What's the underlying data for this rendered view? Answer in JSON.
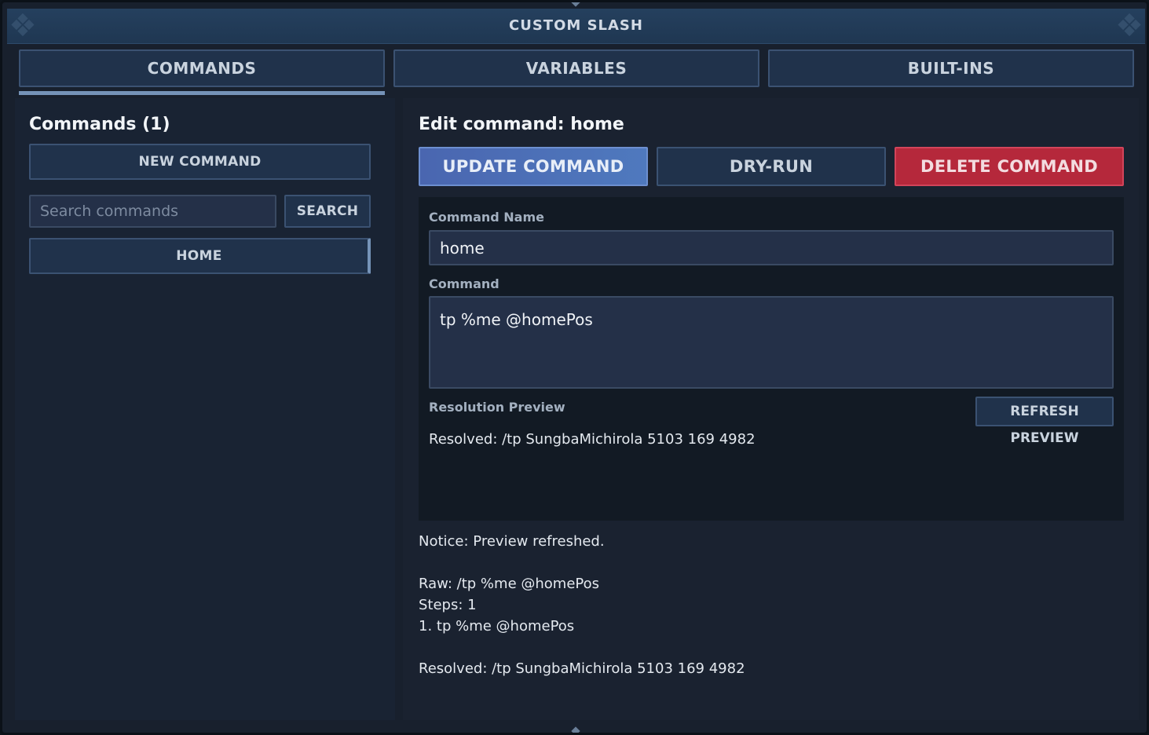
{
  "window": {
    "title": "CUSTOM SLASH"
  },
  "tabs": [
    {
      "label": "COMMANDS",
      "active": true
    },
    {
      "label": "VARIABLES",
      "active": false
    },
    {
      "label": "BUILT-INS",
      "active": false
    }
  ],
  "sidebar": {
    "heading": "Commands (1)",
    "new_button": "NEW COMMAND",
    "search": {
      "placeholder": "Search commands",
      "value": "",
      "button": "SEARCH"
    },
    "items": [
      {
        "label": "HOME",
        "selected": true
      }
    ]
  },
  "editor": {
    "heading": "Edit command: home",
    "buttons": {
      "update": "UPDATE COMMAND",
      "dry_run": "DRY-RUN",
      "delete": "DELETE COMMAND"
    },
    "name_label": "Command Name",
    "name_value": "home",
    "command_label": "Command",
    "command_value": "tp %me @homePos",
    "preview_label": "Resolution Preview",
    "refresh_button": "REFRESH PREVIEW",
    "preview_text": "Resolved: /tp SungbaMichirola 5103 169 4982"
  },
  "output": {
    "notice": "Notice: Preview refreshed.",
    "raw": "Raw: /tp %me @homePos",
    "steps": "Steps: 1",
    "step_1": "1. tp %me @homePos",
    "resolved": "Resolved: /tp SungbaMichirola 5103 169 4982"
  },
  "colors": {
    "primary_button": "#4f6fb8",
    "danger_button": "#b5283b",
    "tab_underline": "#7593b8",
    "selected_item_bar": "#7593b8"
  }
}
